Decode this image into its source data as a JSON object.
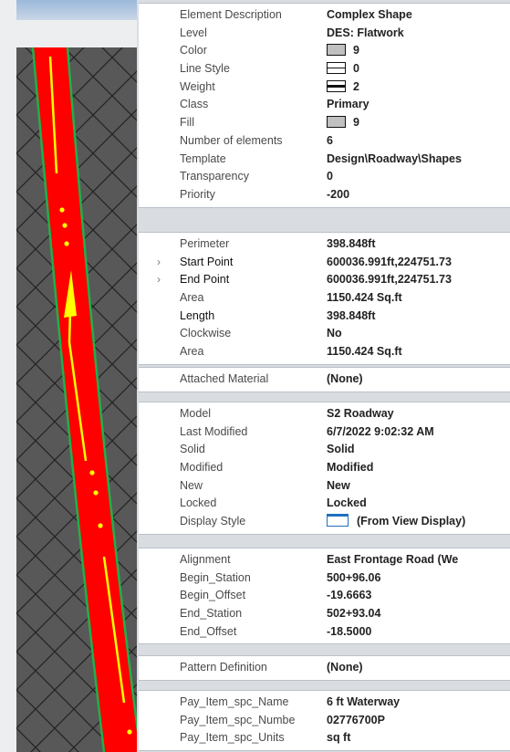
{
  "colors": {
    "road": "#ff0000",
    "edge": "#1fb04a",
    "centerline": "#ffff00",
    "panel_bg": "#d9dde2",
    "grid_bg": "#585858"
  },
  "groups": [
    {
      "id": "general",
      "rows": [
        {
          "label": "Element Description",
          "value": "Complex Shape"
        },
        {
          "label": "Level",
          "value": "DES: Flatwork"
        },
        {
          "label": "Color",
          "value": "9",
          "swatch": "gray"
        },
        {
          "label": "Line Style",
          "value": "0",
          "swatch": "ls"
        },
        {
          "label": "Weight",
          "value": "2",
          "swatch": "wt"
        },
        {
          "label": "Class",
          "value": "Primary"
        },
        {
          "label": "Fill",
          "value": "9",
          "swatch": "gray"
        },
        {
          "label": "Number of elements",
          "value": "6"
        },
        {
          "label": "Template",
          "value": "Design\\Roadway\\Shapes"
        },
        {
          "label": "Transparency",
          "value": "0"
        },
        {
          "label": "Priority",
          "value": "-200"
        }
      ]
    },
    {
      "id": "geometry",
      "rows": [
        {
          "label": "Perimeter",
          "value": "398.848ft"
        },
        {
          "label": "Start Point",
          "value": "600036.991ft,224751.73",
          "expand": true,
          "dark": true
        },
        {
          "label": "End Point",
          "value": "600036.991ft,224751.73",
          "expand": true,
          "dark": true
        },
        {
          "label": "Area",
          "value": "1150.424 Sq.ft"
        },
        {
          "label": "Length",
          "value": "398.848ft",
          "dark": true
        },
        {
          "label": "Clockwise",
          "value": "No"
        },
        {
          "label": "Area",
          "value": "1150.424 Sq.ft"
        }
      ]
    },
    {
      "id": "material",
      "rows": [
        {
          "label": "Attached Material",
          "value": "(None)"
        }
      ]
    },
    {
      "id": "model",
      "rows": [
        {
          "label": "Model",
          "value": "S2 Roadway"
        },
        {
          "label": "Last Modified",
          "value": "6/7/2022 9:02:32 AM"
        },
        {
          "label": "Solid",
          "value": "Solid"
        },
        {
          "label": "Modified",
          "value": "Modified"
        },
        {
          "label": "New",
          "value": "New"
        },
        {
          "label": "Locked",
          "value": "Locked"
        },
        {
          "label": "Display Style",
          "value": "(From View Display)",
          "swatch": "disp"
        }
      ]
    },
    {
      "id": "alignment",
      "rows": [
        {
          "label": "Alignment",
          "value": "East Frontage Road (We"
        },
        {
          "label": "Begin_Station",
          "value": "500+96.06"
        },
        {
          "label": "Begin_Offset",
          "value": "-19.6663"
        },
        {
          "label": "End_Station",
          "value": "502+93.04"
        },
        {
          "label": "End_Offset",
          "value": "-18.5000"
        }
      ]
    },
    {
      "id": "pattern",
      "rows": [
        {
          "label": "Pattern Definition",
          "value": "(None)"
        }
      ]
    },
    {
      "id": "payitem",
      "rows": [
        {
          "label": "Pay_Item_spc_Name",
          "value": "6 ft Waterway"
        },
        {
          "label": "Pay_Item_spc_Numbe",
          "value": "02776700P"
        },
        {
          "label": "Pay_Item_spc_Units",
          "value": "sq ft"
        }
      ]
    }
  ]
}
